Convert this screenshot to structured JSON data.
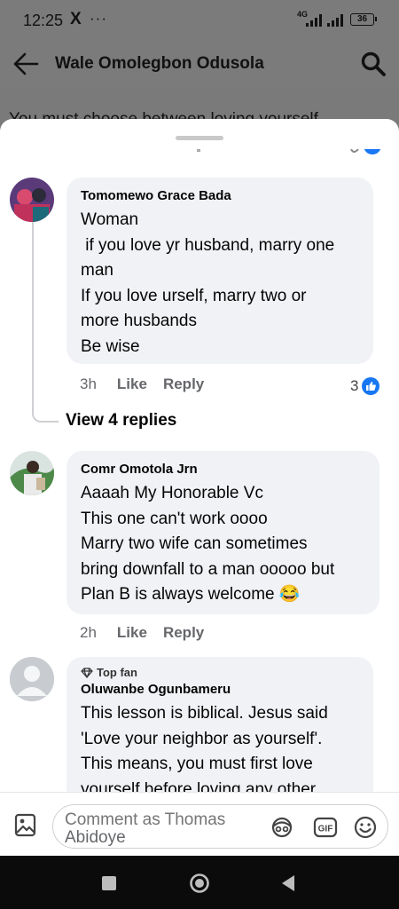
{
  "status_bar": {
    "time": "12:25",
    "x_icon": "X",
    "more": "···",
    "network": "4G",
    "battery": "36"
  },
  "header": {
    "title": "Wale Omolegbon Odusola",
    "background_text": "You must choose between loving yourself"
  },
  "comments": [
    {
      "author": "Tomomewo Grace Bada",
      "text": "Woman\n if you love yr husband, marry one\nman\nIf you love urself, marry two or\nmore husbands\nBe wise",
      "time": "3h",
      "like_label": "Like",
      "reply_label": "Reply",
      "reaction_count": "3",
      "view_replies": "View 4 replies"
    },
    {
      "author": "Comr Omotola Jrn",
      "text": "Aaaah My Honorable Vc\nThis one can't work oooo\nMarry two wife can sometimes\nbring downfall to a man ooooo but\nPlan B is always welcome",
      "emoji": "😂",
      "time": "2h",
      "like_label": "Like",
      "reply_label": "Reply"
    },
    {
      "badge": "Top fan",
      "author": "Oluwanbe Ogunbameru",
      "text": "This lesson is biblical. Jesus said\n'Love your neighbor as yourself'.\nThis means, you must first love\nyourself before loving any other"
    }
  ],
  "composer": {
    "placeholder": "Comment as Thomas Abidoye",
    "line1": "Comment as Thomas",
    "line2": "Abidoye"
  },
  "colors": {
    "accent": "#1877f2",
    "bubble": "#f0f2f5",
    "muted_text": "#65676b"
  }
}
